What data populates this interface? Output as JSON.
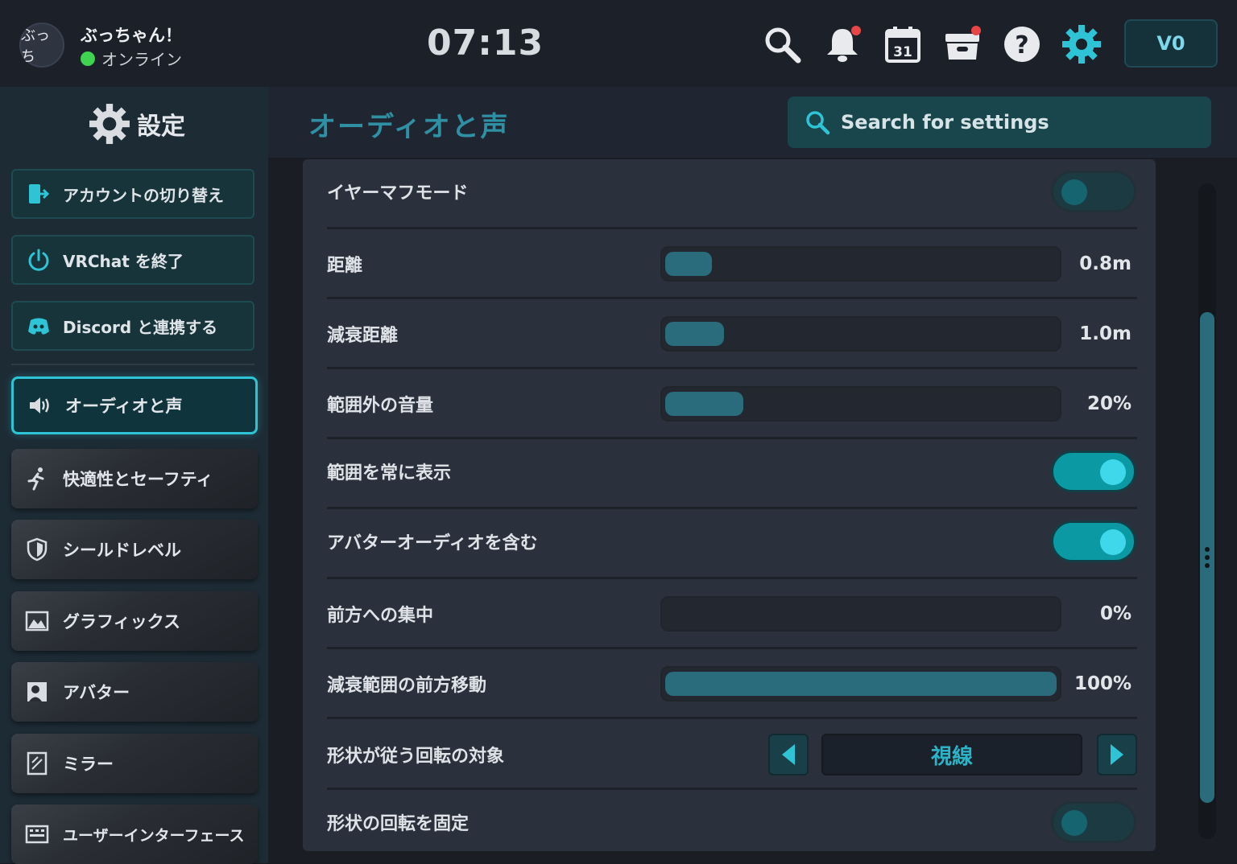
{
  "user": {
    "avatar_text": "ぶっち",
    "name": "ぶっちゃん！",
    "status": "オンライン",
    "status_color": "#3fd351"
  },
  "clock": "07:13",
  "toolbar": {
    "icons": [
      "search-icon",
      "bell-icon",
      "calendar-icon",
      "inventory-icon",
      "help-icon",
      "gear-icon"
    ],
    "calendar_day": "31",
    "currency": "V0"
  },
  "sidebar": {
    "title": "設定",
    "actions": [
      {
        "label": "アカウントの切り替え",
        "icon": "switch-account-icon"
      },
      {
        "label": "VRChat を終了",
        "icon": "power-icon"
      },
      {
        "label": "Discord と連携する",
        "icon": "discord-icon"
      }
    ],
    "nav": [
      {
        "label": "オーディオと声",
        "icon": "speaker-icon",
        "active": true
      },
      {
        "label": "快適性とセーフティ",
        "icon": "running-icon"
      },
      {
        "label": "シールドレベル",
        "icon": "shield-icon"
      },
      {
        "label": "グラフィックス",
        "icon": "image-icon"
      },
      {
        "label": "アバター",
        "icon": "avatar-icon"
      },
      {
        "label": "ミラー",
        "icon": "mirror-icon"
      },
      {
        "label": "ユーザーインターフェース",
        "icon": "keyboard-icon"
      }
    ]
  },
  "page": {
    "title": "オーディオと声",
    "search_placeholder": "Search for settings"
  },
  "settings": [
    {
      "label": "イヤーマフモード",
      "type": "toggle",
      "on": false
    },
    {
      "label": "距離",
      "type": "slider",
      "value_text": "0.8m",
      "fraction": 0.12
    },
    {
      "label": "減衰距離",
      "type": "slider",
      "value_text": "1.0m",
      "fraction": 0.15
    },
    {
      "label": "範囲外の音量",
      "type": "slider",
      "value_text": "20%",
      "fraction": 0.2
    },
    {
      "label": "範囲を常に表示",
      "type": "toggle",
      "on": true
    },
    {
      "label": "アバターオーディオを含む",
      "type": "toggle",
      "on": true
    },
    {
      "label": "前方への集中",
      "type": "slider",
      "value_text": "0%",
      "fraction": 0
    },
    {
      "label": "減衰範囲の前方移動",
      "type": "slider",
      "value_text": "100%",
      "fraction": 1.0
    },
    {
      "label": "形状が従う回転の対象",
      "type": "selector",
      "value_text": "視線"
    },
    {
      "label": "形状の回転を固定",
      "type": "toggle",
      "on": false
    }
  ],
  "colors": {
    "accent": "#2ec4d6",
    "toggle_on": "#0b9aa3",
    "slider_fill": "#2a6b7c"
  }
}
